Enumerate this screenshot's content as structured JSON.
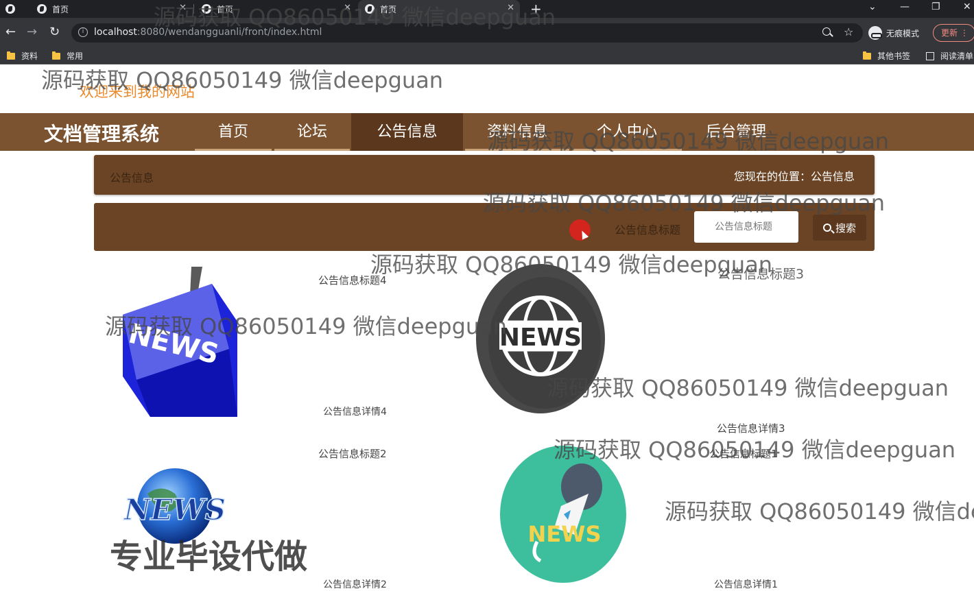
{
  "browser": {
    "tabs": [
      {
        "title": "首页"
      },
      {
        "title": "首页"
      },
      {
        "title": "首页"
      }
    ],
    "new_tab_symbol": "+",
    "window_controls": [
      "⌄",
      "—",
      "❐",
      "✕"
    ],
    "url_host": "localhost",
    "url_rest": ":8080/wendangguanli/front/index.html",
    "incognito_label": "无痕模式",
    "update_label": "更新",
    "bookmarks": [
      "资料",
      "常用"
    ],
    "bookmarks_right": [
      "其他书签",
      "阅读清单"
    ]
  },
  "site": {
    "welcome": "欢迎来到我的网站",
    "brand": "文档管理系统",
    "nav": [
      "首页",
      "论坛",
      "公告信息",
      "资料信息",
      "个人中心",
      "后台管理"
    ],
    "active_nav": "公告信息"
  },
  "breadcrumb": {
    "left": "公告信息",
    "right": "您现在的位置：公告信息"
  },
  "search": {
    "label": "公告信息标题",
    "placeholder": "公告信息标题",
    "button": "搜索"
  },
  "notices": [
    {
      "title": "公告信息标题4",
      "detail": "公告信息详情4",
      "image": "news-keyboard-key"
    },
    {
      "title": "公告信息标题3",
      "detail": "公告信息详情3",
      "image": "news-globe-badge"
    },
    {
      "title": "公告信息标题2",
      "detail": "公告信息详情2",
      "image": "news-blue-globe"
    },
    {
      "title": "公告信息标题1",
      "detail": "公告信息详情1",
      "image": "news-microphone"
    }
  ],
  "image_text": {
    "badge": "NEWS",
    "key": "NEWS",
    "globe": "NEWS",
    "mic": "NEWS"
  },
  "watermarks": {
    "repeat": "源码获取 QQ86050149 微信deepguan",
    "cut": "源码获取 QQ86050149 微信deep",
    "promo": "专业毕设代做"
  }
}
